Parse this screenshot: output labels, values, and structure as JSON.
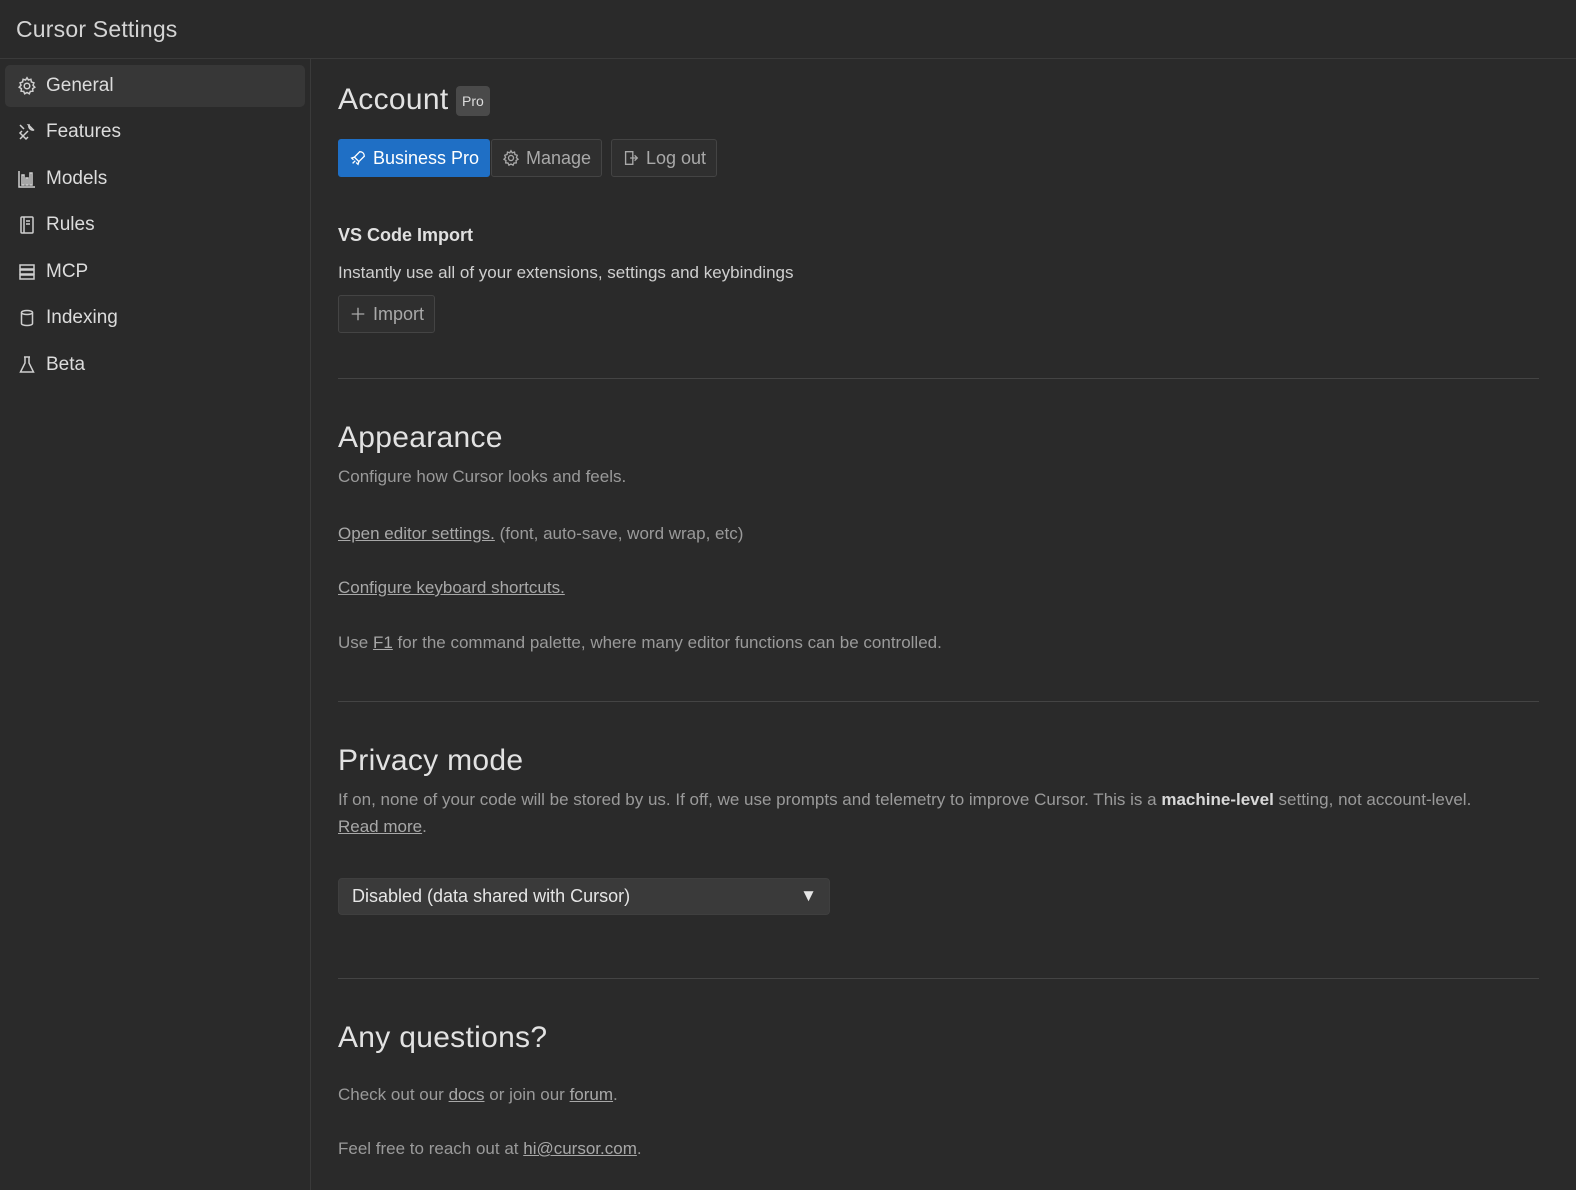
{
  "window": {
    "title": "Cursor Settings"
  },
  "sidebar": {
    "items": [
      {
        "label": "General",
        "icon": "gear-icon",
        "active": true
      },
      {
        "label": "Features",
        "icon": "tools-icon",
        "active": false
      },
      {
        "label": "Models",
        "icon": "bar-chart-icon",
        "active": false
      },
      {
        "label": "Rules",
        "icon": "book-icon",
        "active": false
      },
      {
        "label": "MCP",
        "icon": "server-icon",
        "active": false
      },
      {
        "label": "Indexing",
        "icon": "database-icon",
        "active": false
      },
      {
        "label": "Beta",
        "icon": "flask-icon",
        "active": false
      }
    ]
  },
  "account": {
    "heading": "Account",
    "badge": "Pro",
    "buttons": {
      "business_pro": "Business Pro",
      "manage": "Manage",
      "logout": "Log out"
    }
  },
  "vscode_import": {
    "heading": "VS Code Import",
    "description": "Instantly use all of your extensions, settings and keybindings",
    "button": "Import"
  },
  "appearance": {
    "heading": "Appearance",
    "description": "Configure how Cursor looks and feels.",
    "editor_settings_link": "Open editor settings.",
    "editor_settings_hint": "(font, auto-save, word wrap, etc)",
    "keyboard_link": "Configure keyboard shortcuts.",
    "palette_prefix": "Use",
    "palette_key": "F1",
    "palette_suffix": "for the command palette, where many editor functions can be controlled."
  },
  "privacy": {
    "heading": "Privacy mode",
    "description_start": "If on, none of your code will be stored by us. If off, we use prompts and telemetry to improve Cursor. This is a",
    "description_bold": "machine-level",
    "description_end": "setting, not account-level.",
    "read_more": "Read more",
    "read_more_suffix": ".",
    "select_value": "Disabled (data shared with Cursor)",
    "caret": "▼"
  },
  "questions": {
    "heading": "Any questions?",
    "line1_prefix": "Check out our",
    "docs_link": "docs",
    "line1_mid": "or join our",
    "forum_link": "forum",
    "line1_suffix": ".",
    "line2_prefix": "Feel free to reach out at",
    "email_link": "hi@cursor.com",
    "line2_suffix": "."
  },
  "colors": {
    "background": "#2a2a2a",
    "accent": "#1f6fc5",
    "active_nav": "#373737"
  }
}
